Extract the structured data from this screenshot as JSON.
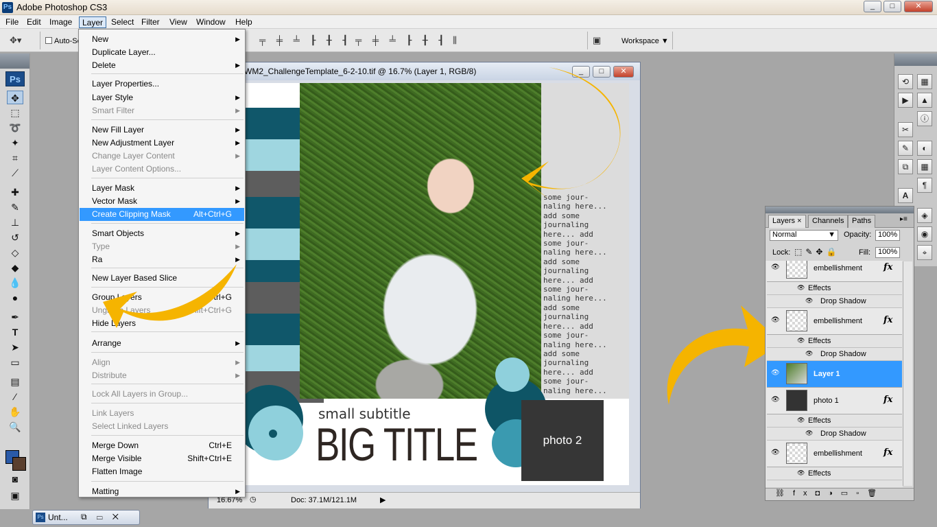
{
  "app": {
    "title": "Adobe Photoshop CS3",
    "badge": "Ps"
  },
  "window_buttons": [
    "_",
    "□",
    "✕"
  ],
  "menubar": [
    "File",
    "Edit",
    "Image",
    "Layer",
    "Select",
    "Filter",
    "View",
    "Window",
    "Help"
  ],
  "options_bar": {
    "auto_select_label": "Auto-Se",
    "workspace_label": "Workspace ▼"
  },
  "layer_menu": {
    "items": [
      {
        "label": "New",
        "submenu": true
      },
      {
        "label": "Duplicate Layer..."
      },
      {
        "label": "Delete",
        "submenu": true
      },
      {
        "label": "Layer Properties..."
      },
      {
        "label": "Layer Style",
        "submenu": true
      },
      {
        "label": "Smart Filter",
        "disabled": true,
        "submenu": true
      },
      {
        "label": "New Fill Layer",
        "submenu": true
      },
      {
        "label": "New Adjustment Layer",
        "submenu": true
      },
      {
        "label": "Change Layer Content",
        "disabled": true,
        "submenu": true
      },
      {
        "label": "Layer Content Options...",
        "disabled": true
      },
      {
        "label": "Layer Mask",
        "submenu": true
      },
      {
        "label": "Vector Mask",
        "submenu": true
      },
      {
        "label": "Create Clipping Mask",
        "shortcut": "Alt+Ctrl+G",
        "highlighted": true
      },
      {
        "label": "Smart Objects",
        "submenu": true
      },
      {
        "label": "Type",
        "disabled": true,
        "submenu": true
      },
      {
        "label": "Ra",
        "submenu": true
      },
      {
        "label": "New Layer Based Slice"
      },
      {
        "label": "Group Layers",
        "shortcut": "Ctrl+G"
      },
      {
        "label": "Ungroup Layers",
        "shortcut": "Shift+Ctrl+G",
        "disabled": true
      },
      {
        "label": "Hide Layers"
      },
      {
        "label": "Arrange",
        "submenu": true
      },
      {
        "label": "Align",
        "disabled": true,
        "submenu": true
      },
      {
        "label": "Distribute",
        "disabled": true,
        "submenu": true
      },
      {
        "label": "Lock All Layers in Group...",
        "disabled": true
      },
      {
        "label": "Link Layers",
        "disabled": true
      },
      {
        "label": "Select Linked Layers",
        "disabled": true
      },
      {
        "label": "Merge Down",
        "shortcut": "Ctrl+E"
      },
      {
        "label": "Merge Visible",
        "shortcut": "Shift+Ctrl+E"
      },
      {
        "label": "Flatten Image"
      },
      {
        "label": "Matting",
        "submenu": true
      }
    ]
  },
  "document": {
    "title": "WM2_ChallengeTemplate_6-2-10.tif @ 16.7% (Layer 1, RGB/8)",
    "zoom": "16.67%",
    "doc_size": "Doc: 37.1M/121.1M",
    "subtitle": "small subtitle",
    "big_title": "BIG TITLE",
    "photo2_label": "photo 2",
    "journaling": "some jour-\nnaling here...\nadd some\njournaling\nhere... add\nsome jour-\nnaling here...\nadd some\njournaling\nhere... add\nsome jour-\nnaling here...\nadd some\njournaling\nhere... add\nsome jour-\nnaling here...\nadd some\njournaling\nhere... add\nsome jour-\nnaling here..."
  },
  "layers_panel": {
    "tabs": [
      "Layers ×",
      "Channels",
      "Paths"
    ],
    "blend_mode": "Normal",
    "opacity_label": "Opacity:",
    "opacity_value": "100%",
    "lock_label": "Lock:",
    "fill_label": "Fill:",
    "fill_value": "100%",
    "layers": [
      {
        "name": "embellishment",
        "fx": true,
        "effects": [
          "Effects",
          "Drop Shadow"
        ]
      },
      {
        "name": "embellishment",
        "fx": true,
        "effects": [
          "Effects",
          "Drop Shadow"
        ]
      },
      {
        "name": "Layer 1",
        "active": true
      },
      {
        "name": "photo 1",
        "fx": true,
        "effects": [
          "Effects",
          "Drop Shadow"
        ]
      },
      {
        "name": "embellishment",
        "fx": true,
        "effects": [
          "Effects"
        ]
      }
    ]
  },
  "taskbar": {
    "minimized_label": "Unt..."
  },
  "colors": {
    "accent_highlight": "#3399ff",
    "arrow_yellow": "#f5b400",
    "teal_dark": "#0e5566",
    "teal_light": "#9dd6e0"
  }
}
